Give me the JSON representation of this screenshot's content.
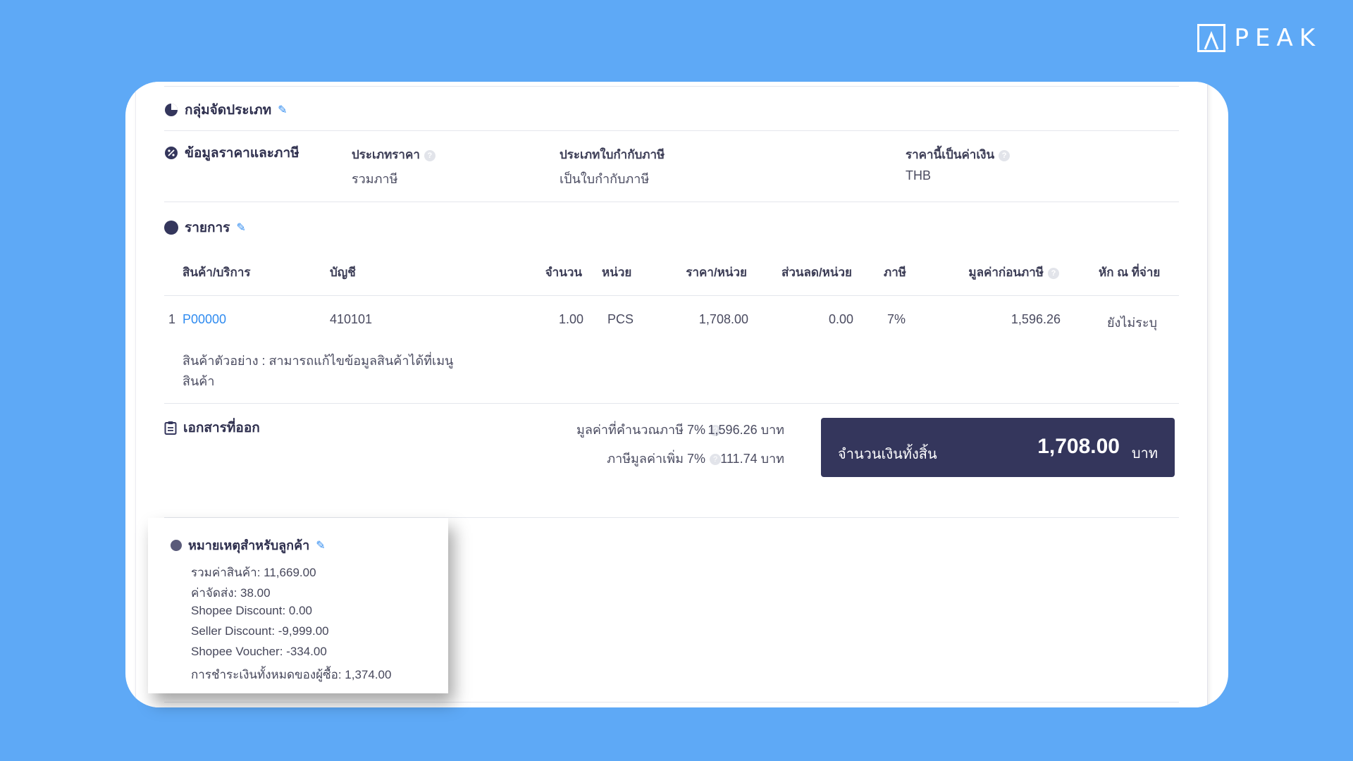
{
  "brand": {
    "name": "PEAK"
  },
  "sections": {
    "category": {
      "title": "กลุ่มจัดประเภท"
    },
    "pricing": {
      "title": "ข้อมูลราคาและภาษี",
      "price_type_label": "ประเภทราคา",
      "price_type_value": "รวมภาษี",
      "tax_invoice_label": "ประเภทใบกำกับภาษี",
      "tax_invoice_value": "เป็นใบกำกับภาษี",
      "currency_label": "ราคานี้เป็นค่าเงิน",
      "currency_value": "THB"
    },
    "items": {
      "title": "รายการ",
      "headers": {
        "product": "สินค้า/บริการ",
        "account": "บัญชี",
        "qty": "จำนวน",
        "unit": "หน่วย",
        "price": "ราคา/หน่วย",
        "discount": "ส่วนลด/หน่วย",
        "tax": "ภาษี",
        "pretax": "มูลค่าก่อนภาษี",
        "withholding": "หัก ณ ที่จ่าย"
      },
      "rows": [
        {
          "no": "1",
          "product": "P00000",
          "account": "410101",
          "qty": "1.00",
          "unit": "PCS",
          "price": "1,708.00",
          "discount": "0.00",
          "tax": "7%",
          "pretax": "1,596.26",
          "withholding": "ยังไม่ระบุ",
          "desc_line1": "สินค้าตัวอย่าง : สามารถแก้ไขข้อมูลสินค้าได้ที่เมนู",
          "desc_line2": "สินค้า"
        }
      ]
    },
    "documents": {
      "title": "เอกสารที่ออก"
    },
    "summary": {
      "taxable_label": "มูลค่าที่คำนวณภาษี 7%",
      "taxable_value": "1,596.26 บาท",
      "vat_label": "ภาษีมูลค่าเพิ่ม 7%",
      "vat_value": "111.74 บาท",
      "total_label": "จำนวนเงินทั้งสิ้น",
      "total_amount": "1,708.00",
      "total_currency": "บาท"
    },
    "customer_note": {
      "title": "หมายเหตุสำหรับลูกค้า",
      "lines": [
        "รวมค่าสินค้า: 11,669.00",
        "ค่าจัดส่ง: 38.00",
        "Shopee Discount: 0.00",
        "Seller Discount: -9,999.00",
        "Shopee Voucher: -334.00",
        "การชำระเงินทั้งหมดของผู้ซื้อ: 1,374.00"
      ]
    }
  },
  "colors": {
    "background": "#5EA9F6",
    "navy": "#34365C",
    "link": "#2F8BF0"
  },
  "icons": [
    "pie-chart-icon",
    "percent-badge-icon",
    "pencil-icon",
    "help-icon",
    "clipboard-icon"
  ]
}
